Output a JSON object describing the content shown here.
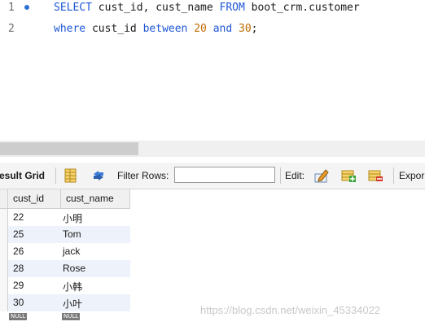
{
  "editor": {
    "line1_num": "1",
    "line2_num": "2",
    "line1": {
      "kw1": "SELECT",
      "text1": " cust_id, cust_name ",
      "kw2": "FROM",
      "text2": " boot_crm.customer"
    },
    "line2": {
      "kw1": "where",
      "text1": " cust_id ",
      "kw2": "between",
      "sp1": " ",
      "n1": "20",
      "sp2": " ",
      "kw3": "and",
      "sp3": " ",
      "n2": "30",
      "end": ";"
    }
  },
  "toolbar": {
    "result_grid_label": "esult Grid",
    "filter_rows_label": "Filter Rows:",
    "filter_value": "",
    "edit_label": "Edit:",
    "export_label": "Expor"
  },
  "grid": {
    "columns": [
      "cust_id",
      "cust_name"
    ],
    "rows": [
      [
        "22",
        "小明"
      ],
      [
        "25",
        "Tom"
      ],
      [
        "26",
        "jack"
      ],
      [
        "28",
        "Rose"
      ],
      [
        "29",
        "小韩"
      ],
      [
        "30",
        "小叶"
      ]
    ],
    "null_label": "NULL"
  },
  "watermark": "https://blog.csdn.net/weixin_45334022",
  "colors": {
    "keyword": "#1e56d6",
    "number": "#c06a00",
    "breakpoint": "#2f6fd6",
    "alt_row": "#eef2fb"
  }
}
